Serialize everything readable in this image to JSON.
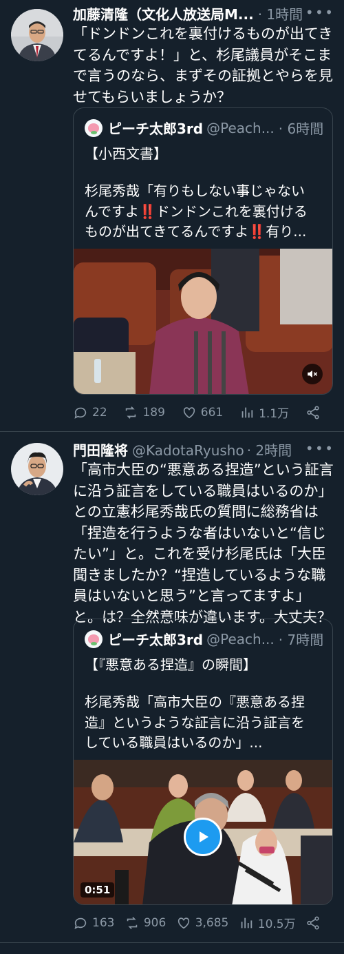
{
  "tweets": [
    {
      "author_name": "加藤清隆（文化人放送局M...",
      "author_handle": "",
      "time": "· 1時間",
      "text": [
        "「ドンドンこれを裏付けるものが出てき",
        "てるんですよ！」と、杉尾議員がそこま",
        "で言うのなら、まずその証拠とやらを見",
        "せてもらいましょうか？"
      ],
      "quote": {
        "author_name": "ピーチ太郎3rd",
        "author_handle": "@Peach...",
        "time": "· 6時間",
        "title": "【小西文書】",
        "body": [
          "杉尾秀哉「有りもしない事じゃない",
          "んですよ‼️ドンドンこれを裏付ける",
          "ものが出てきてるんですよ‼️有り..."
        ],
        "media_icon": "mute-icon"
      },
      "stats": {
        "replies": "22",
        "retweets": "189",
        "likes": "661",
        "views": "1.1万"
      }
    },
    {
      "author_name": "門田隆将",
      "author_handle": "@KadotaRyusho",
      "time": "· 2時間",
      "text": [
        "「高市大臣の“悪意ある捏造”という証言",
        "に沿う証言をしている職員はいるのか」",
        "との立憲杉尾秀哉氏の質問に総務省は",
        "「捏造を行うような者はいないと“信じ",
        "たい”」と。これを受け杉尾氏は「大臣",
        "聞きましたか？“捏造しているような職",
        "員はいないと思う”と言ってますよ」",
        "と。は？全然意味が違います。大丈夫？"
      ],
      "quote": {
        "author_name": "ピーチ太郎3rd",
        "author_handle": "@Peach...",
        "time": "· 7時間",
        "title": "【『悪意ある捏造』の瞬間】",
        "body": [
          "杉尾秀哉「高市大臣の『悪意ある捏",
          "造』というような証言に沿う証言を",
          "している職員はいるのか」..."
        ],
        "video_duration": "0:51"
      },
      "stats": {
        "replies": "163",
        "retweets": "906",
        "likes": "3,685",
        "views": "10.5万"
      }
    }
  ],
  "colors": {
    "background": "#15202b",
    "muted": "#8b98a5",
    "border": "#38444d",
    "accent": "#1d9bf0"
  }
}
